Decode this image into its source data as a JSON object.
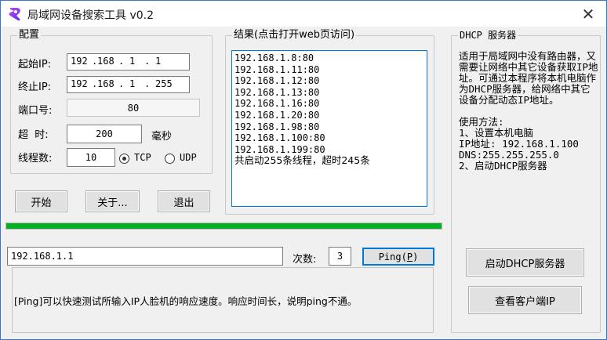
{
  "window": {
    "title": "局域网设备搜索工具 v0.2",
    "close_glyph": "✕",
    "icon": "app-logo-icon",
    "accent": "#3b77c9"
  },
  "config": {
    "legend": "配置",
    "start_ip_label": "起始IP:",
    "start_ip": [
      "192",
      "168",
      "1",
      "1"
    ],
    "end_ip_label": "终止IP:",
    "end_ip": [
      "192",
      "168",
      "1",
      "255"
    ],
    "port_label": "端口号:",
    "port_value": "80",
    "timeout_label": "超  时:",
    "timeout_value": "200",
    "timeout_unit": "毫秒",
    "threads_label": "线程数:",
    "threads_value": "10",
    "protocols": [
      {
        "label": "TCP",
        "selected": true
      },
      {
        "label": "UDP",
        "selected": false
      }
    ]
  },
  "buttons": {
    "start": "开始",
    "about": "关于...",
    "exit": "退出"
  },
  "results": {
    "legend": "结果(点击打开web页访问)",
    "items": [
      "192.168.1.8:80",
      "192.168.1.11:80",
      "192.168.1.12:80",
      "192.168.1.13:80",
      "192.168.1.16:80",
      "192.168.1.20:80",
      "192.168.1.98:80",
      "192.168.1.100:80",
      "192.168.1.199:80",
      "共启动255条线程，超时245条"
    ]
  },
  "dhcp": {
    "legend": "DHCP 服务器",
    "description": "适用于局域网中没有路由器，又需要让网络中其它设备获取IP地址。可通过本程序将本机电脑作为DHCP服务器，给网络中其它设备分配动态IP地址。",
    "usage_title": "使用方法:",
    "usage_lines": [
      "1、设置本机电脑",
      "IP地址: 192.168.1.100",
      "DNS:255.255.255.0",
      "2、启动DHCP服务器"
    ],
    "start_button": "启动DHCP服务器",
    "view_clients_button": "查看客户端IP"
  },
  "progress": {
    "value": 1.0,
    "color": "#06b025"
  },
  "ping": {
    "ip_value": "192.168.1.1",
    "count_label": "次数:",
    "count_value": "3",
    "button_label": "Ping(P)",
    "message": "[Ping]可以快速测试所输入IP人脸机的响应速度。响应时间长，说明ping不通。"
  }
}
